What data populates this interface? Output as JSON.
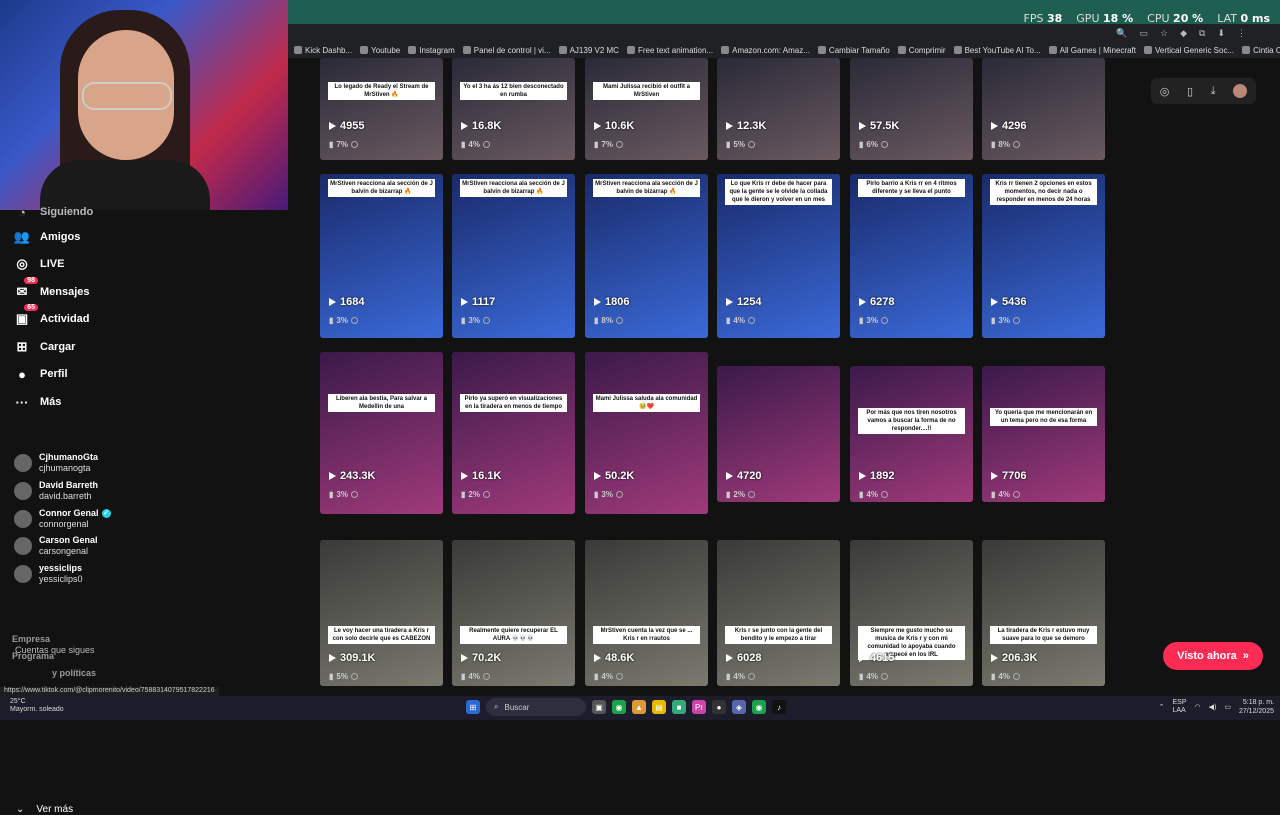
{
  "perf": {
    "fps_label": "FPS",
    "fps": "38",
    "gpu_label": "GPU",
    "gpu": "18 %",
    "cpu_label": "CPU",
    "cpu": "20 %",
    "lat_label": "LAT",
    "lat": "0 ms"
  },
  "bookmarks": [
    "Kick Dashb...",
    "Youtube",
    "Instagram",
    "Panel de control | vi...",
    "AJ139 V2 MC",
    "Free text animation...",
    "Amazon.com: Amaz...",
    "Cambiar Tamaño",
    "Comprimir",
    "Best YouTube AI To...",
    "All Games | Minecraft",
    "Vertical Generic Soc...",
    "Cintia Cossio al Des..."
  ],
  "bookmarks_all": "Todos los favoritos",
  "sidebar": {
    "partial_item": "Siguiendo",
    "items": [
      {
        "label": "Amigos",
        "icon": "friends-icon"
      },
      {
        "label": "LIVE",
        "icon": "live-icon"
      },
      {
        "label": "Mensajes",
        "icon": "messages-icon",
        "badge": "98"
      },
      {
        "label": "Actividad",
        "icon": "activity-icon",
        "badge": "65"
      },
      {
        "label": "Cargar",
        "icon": "upload-icon"
      },
      {
        "label": "Perfil",
        "icon": "profile-icon"
      },
      {
        "label": "Más",
        "icon": "more-icon"
      }
    ],
    "following_title": "Cuentas que sigues",
    "following": [
      {
        "name": "CjhumanoGta",
        "handle": "cjhumanogta"
      },
      {
        "name": "David Barreth",
        "handle": "david.barreth"
      },
      {
        "name": "Connor Genal",
        "handle": "connorgenal",
        "verified": true
      },
      {
        "name": "Carson Genal",
        "handle": "carsongenal"
      },
      {
        "name": "yessiclips",
        "handle": "yessiclips0"
      }
    ],
    "see_more": "Ver más",
    "footer": [
      "Empresa",
      "Programa",
      "y políticas"
    ]
  },
  "status_url": "https://www.tiktok.com/@clipmorenito/video/7588314079517822216",
  "videos": [
    {
      "views": "4955",
      "pct": "7%",
      "caption": "Lo legado de Ready el Stream de MrStiven 🔥"
    },
    {
      "views": "16.8K",
      "pct": "4%",
      "caption": "Yo el 3 ha ás 12 bien desconectado en rumba"
    },
    {
      "views": "10.6K",
      "pct": "7%",
      "caption": "Mami Julissa recibió el outfit a MrStiven"
    },
    {
      "views": "12.3K",
      "pct": "5%",
      "caption": ""
    },
    {
      "views": "57.5K",
      "pct": "6%",
      "caption": ""
    },
    {
      "views": "4296",
      "pct": "8%",
      "caption": ""
    },
    {
      "views": "1684",
      "pct": "3%",
      "caption": "MrStiven reacciona ala sección de J balvin de bizarrap 🔥"
    },
    {
      "views": "1117",
      "pct": "3%",
      "caption": "MrStiven reacciona ala sección de J balvin de bizarrap 🔥"
    },
    {
      "views": "1806",
      "pct": "8%",
      "caption": "MrStiven reacciona ala sección de J balvin de bizarrap 🔥"
    },
    {
      "views": "1254",
      "pct": "4%",
      "caption": "Lo que Kris rr debe de hacer para que la gente se le olvide la collada que le dieron y volver en un mes"
    },
    {
      "views": "6278",
      "pct": "3%",
      "caption": "Pirlo barrio a Kris rr en 4 ritmos diferente y se lleva el punto"
    },
    {
      "views": "5436",
      "pct": "3%",
      "caption": "Kris rr tienen 2 opciones en estos momentos, no decir nada o responder en menos de 24 horas"
    },
    {
      "views": "243.3K",
      "pct": "3%",
      "caption": "Liberen ala bestia, Para salvar a Medellin de una"
    },
    {
      "views": "16.1K",
      "pct": "2%",
      "caption": "Pirlo ya superó en visualizaciones en la tiradera en menos de tiempo"
    },
    {
      "views": "50.2K",
      "pct": "3%",
      "caption": "Mami Julissa saluda ala comunidad 🥹❤️"
    },
    {
      "views": "4720",
      "pct": "2%",
      "caption": ""
    },
    {
      "views": "1892",
      "pct": "4%",
      "caption": "Por más que nos tiren nosotros vamos a buscar la forma de no responder....!!"
    },
    {
      "views": "7706",
      "pct": "4%",
      "caption": "Yo queria que me mencionarán en un tema pero no de esa forma"
    },
    {
      "views": "309.1K",
      "pct": "5%",
      "caption": "Le voy hacer una tiradera a Kris r con solo decirle que es CABEZON"
    },
    {
      "views": "70.2K",
      "pct": "4%",
      "caption": "Realmente quiere recuperar EL AURA 💀💀💀"
    },
    {
      "views": "48.6K",
      "pct": "4%",
      "caption": "MrStiven cuenta la vez que se ... Kris r en rrautos"
    },
    {
      "views": "6028",
      "pct": "4%",
      "caption": "Kris r se junto con la gente del bendito y le empezo a tirar"
    },
    {
      "views": "4615",
      "pct": "4%",
      "caption": "Siempre me gusto mucho su musica de Kris r y con mi comunidad lo apoyaba cuando empecé en los IRL"
    },
    {
      "views": "206.3K",
      "pct": "4%",
      "caption": "La tiradera de Kris r estuvo muy suave para lo que se demoro"
    }
  ],
  "visto": "Visto ahora",
  "taskbar": {
    "temp": "25°C",
    "weather": "Mayorm. soleado",
    "search": "Buscar",
    "lang1": "ESP",
    "lang2": "LAA",
    "time": "5:18 p. m.",
    "date": "27/12/2025"
  }
}
